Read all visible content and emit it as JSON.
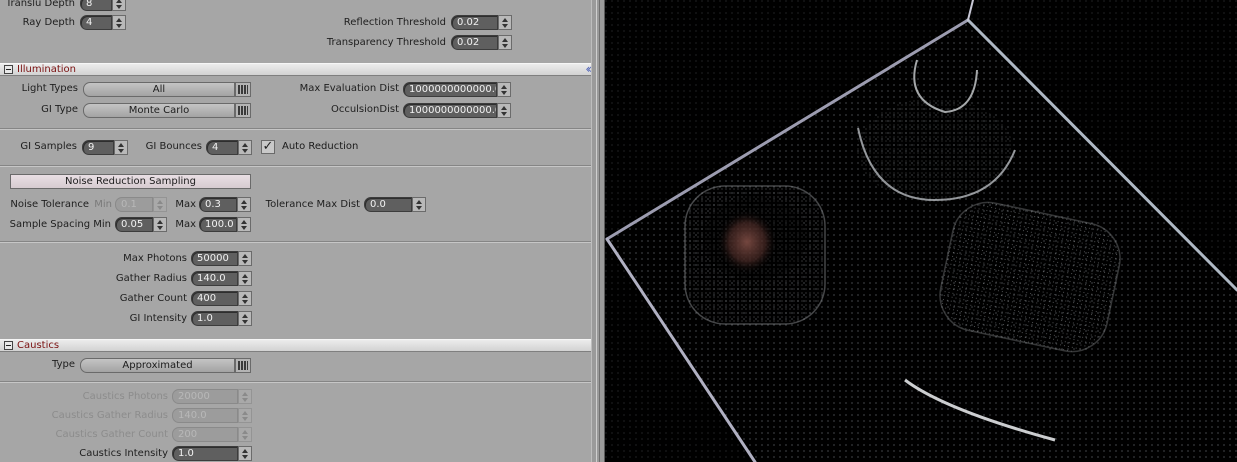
{
  "render_settings": {
    "translu_depth": {
      "label": "Translu Depth",
      "value": "8"
    },
    "ray_depth": {
      "label": "Ray Depth",
      "value": "4"
    },
    "reflection_threshold": {
      "label": "Reflection Threshold",
      "value": "0.02"
    },
    "transparency_threshold": {
      "label": "Transparency Threshold",
      "value": "0.02"
    }
  },
  "illumination": {
    "title": "Illumination",
    "collapse_glyph": "‹‹",
    "light_types": {
      "label": "Light Types",
      "value": "All"
    },
    "gi_type": {
      "label": "GI Type",
      "value": "Monte Carlo"
    },
    "max_evaluation_dist": {
      "label": "Max Evaluation Dist",
      "value": "1000000000000.0"
    },
    "occlusion_dist": {
      "label": "OcculsionDist",
      "value": "1000000000000.0"
    },
    "gi_samples": {
      "label": "GI Samples",
      "value": "9"
    },
    "gi_bounces": {
      "label": "GI Bounces",
      "value": "4"
    },
    "auto_reduction": {
      "label": "Auto Reduction",
      "checked": true,
      "mark": "✓"
    },
    "noise_reduction": {
      "button_label": "Noise Reduction Sampling",
      "noise_tolerance_label": "Noise Tolerance",
      "min_label": "Min",
      "noise_tolerance_min": "0.1",
      "max_label": "Max",
      "noise_tolerance_max": "0.3",
      "tolerance_max_dist_label": "Tolerance Max Dist",
      "tolerance_max_dist": "0.0",
      "sample_spacing_label": "Sample Spacing Min",
      "sample_spacing_min": "0.05",
      "sample_spacing_max": "100.0"
    },
    "photons": {
      "max_photons": {
        "label": "Max Photons",
        "value": "50000"
      },
      "gather_radius": {
        "label": "Gather Radius",
        "value": "140.0"
      },
      "gather_count": {
        "label": "Gather Count",
        "value": "400"
      },
      "gi_intensity": {
        "label": "GI Intensity",
        "value": "1.0"
      }
    }
  },
  "caustics": {
    "title": "Caustics",
    "type": {
      "label": "Type",
      "value": "Approximated"
    },
    "caustics_photons": {
      "label": "Caustics Photons",
      "value": "20000"
    },
    "caustics_gather_radius": {
      "label": "Caustics Gather Radius",
      "value": "140.0"
    },
    "caustics_gather_count": {
      "label": "Caustics Gather Count",
      "value": "200"
    },
    "caustics_intensity": {
      "label": "Caustics Intensity",
      "value": "1.0"
    }
  },
  "viewport": {
    "background": "#000000",
    "frame_color": "#b8b8c8",
    "caustic_tint": "#c48a80"
  }
}
